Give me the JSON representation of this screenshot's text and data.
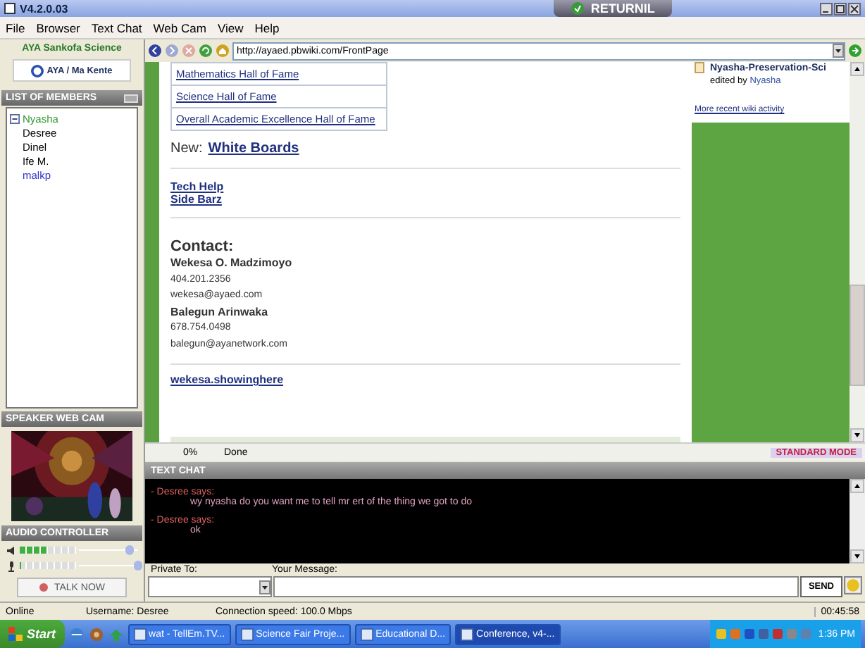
{
  "window": {
    "title": "V4.2.0.03",
    "badge": "RETURNIL"
  },
  "menu": [
    "File",
    "Browser",
    "Text Chat",
    "Web Cam",
    "View",
    "Help"
  ],
  "sidebar": {
    "title": "AYA Sankofa Science",
    "logo_button": "AYA / Ma Kente",
    "members": {
      "title": "LIST OF MEMBERS",
      "items": [
        {
          "name": "Nyasha",
          "expanded": true,
          "color": "#339933",
          "children": [
            {
              "name": "Desree",
              "color": "#000000"
            },
            {
              "name": "Dinel",
              "color": "#000000"
            },
            {
              "name": "Ife M.",
              "color": "#000000"
            },
            {
              "name": "malkp",
              "color": "#3333cc"
            }
          ]
        }
      ]
    },
    "webcam": {
      "title": "SPEAKER WEB CAM",
      "kind": "picture"
    },
    "audio": {
      "title": "AUDIO CONTROLLER",
      "channels": [
        {
          "kind": "speaker",
          "level": 0.5,
          "volume": {
            "level": 0.85
          }
        },
        {
          "kind": "microphone",
          "level": 0,
          "volume": {
            "level": 1
          }
        }
      ],
      "talk_button": "TALK NOW"
    }
  },
  "browser": {
    "url": "http://ayaed.pbwiki.com/FrontPage",
    "page": {
      "hall_links": [
        "Mathematics Hall of Fame",
        "Science Hall of Fame",
        "Overall Academic Excellence Hall of Fame"
      ],
      "new_label": "New:",
      "new_link": "White Boards",
      "links": [
        "Tech Help",
        "Side Barz"
      ],
      "contact_heading": "Contact:",
      "contact_lines": [
        {
          "text": "Wekesa O. Madzimoyo",
          "bold": true
        },
        {
          "text": "404.201.2356",
          "bold": false
        },
        {
          "text": "wekesa@ayaed.com",
          "bold": false
        },
        {
          "text": "Balegun Arinwaka",
          "bold": true
        },
        {
          "text": "678.754.0498",
          "bold": false
        },
        {
          "text": "balegun@ayanetwork.com",
          "bold": false
        }
      ],
      "footer_link": "wekesa.showinghere"
    },
    "activity": {
      "page": "Nyasha-Preservation-Sci",
      "edited_by": "edited by",
      "editor": "Nyasha",
      "more_link": "More recent wiki activity"
    },
    "status": {
      "progress": "0%",
      "state": "Done",
      "mode": "STANDARD MODE"
    }
  },
  "text_chat": {
    "title": "TEXT CHAT",
    "messages": [
      {
        "sender": "- Desree says:",
        "text": "wy nyasha do you want me to tell mr ert of the thing we got to do"
      },
      {
        "sender": "- Desree says:",
        "text": "ok"
      }
    ],
    "private_label": "Private To:",
    "message_label": "Your Message:",
    "send_button": "SEND"
  },
  "status_bar": [
    "Online",
    "Username: Desree",
    "Connection speed: 100.0 Mbps",
    "00:45:58"
  ],
  "taskbar": {
    "start": "Start",
    "tasks": [
      {
        "label": "wat - TellEm.TV...",
        "selected": false
      },
      {
        "label": "Science Fair Proje...",
        "selected": false
      },
      {
        "label": "Educational D...",
        "selected": false
      },
      {
        "label": "Conference, v4-...",
        "selected": true
      }
    ],
    "clock": "1:36 PM"
  }
}
